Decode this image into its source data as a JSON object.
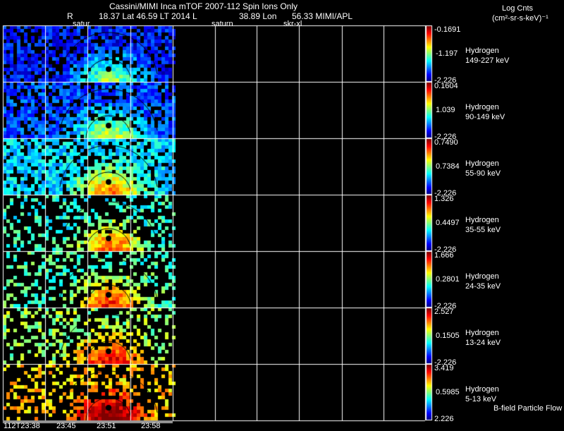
{
  "header": {
    "title": "Cassini/MIMI Inca mTOF  2007-112   Spin   Ions Only",
    "line2_r": "R",
    "line2": "18.37 Lat 46.59 LT 2014 L",
    "lon": "38.89 Lon",
    "lon_val": "56.33  MIMI/APL",
    "labels": [
      "satur",
      "saturn",
      "skr-xl"
    ]
  },
  "units": {
    "line1": "Log Cnts",
    "line2": "(cm²-sr-s-keV)⁻¹"
  },
  "chart_data": {
    "type": "heatmap",
    "title": "Cassini/MIMI Inca mTOF 2007-112 Spin Ions Only",
    "x_ticks": [
      "112T23:38",
      "23:45",
      "23:51",
      "23:58"
    ],
    "panels": [
      {
        "species": "Hydrogen",
        "energy": "149-227 keV",
        "cmax": "-0.1691",
        "cmid": "-1.197",
        "cmin": "-2.226",
        "level": 0.15
      },
      {
        "species": "Hydrogen",
        "energy": "90-149 keV",
        "cmax": "0.1604",
        "cmid": "1.039",
        "cmin": "-2.226",
        "level": 0.22
      },
      {
        "species": "Hydrogen",
        "energy": "55-90 keV",
        "cmax": "0.7490",
        "cmid": "0.7384",
        "cmin": "-2.226",
        "level": 0.38
      },
      {
        "species": "Hydrogen",
        "energy": "35-55 keV",
        "cmax": "1.326",
        "cmid": "0.4497",
        "cmin": "-2.226",
        "level": 0.45
      },
      {
        "species": "Hydrogen",
        "energy": "24-35 keV",
        "cmax": "1.666",
        "cmid": "0.2801",
        "cmin": "-2.226",
        "level": 0.5
      },
      {
        "species": "Hydrogen",
        "energy": "13-24 keV",
        "cmax": "2.527",
        "cmid": "0.1505",
        "cmin": "-2.226",
        "level": 0.58
      },
      {
        "species": "Hydrogen",
        "energy": "5-13 keV",
        "cmax": "3.419",
        "cmid": "0.5985",
        "cmin": "2.226",
        "level": 0.75
      }
    ],
    "footer_note": "B-field Particle Flow"
  }
}
